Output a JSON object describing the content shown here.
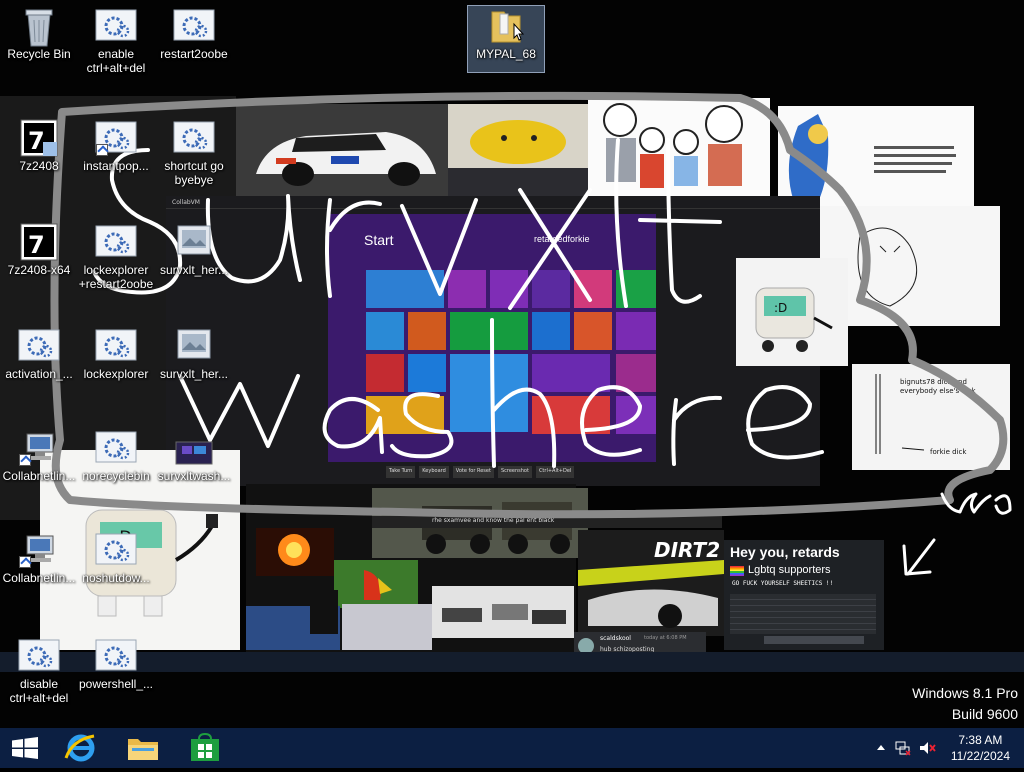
{
  "desktop": {
    "icons": [
      {
        "label": "Recycle Bin",
        "kind": "recycle-bin"
      },
      {
        "label": "enable ctrl+alt+del",
        "kind": "script"
      },
      {
        "label": "restart2oobe",
        "kind": "script"
      },
      {
        "label": "MYPAL_68",
        "kind": "folder",
        "selected": true
      },
      {
        "label": "7z2408",
        "kind": "7zip-installer"
      },
      {
        "label": "instantpop...",
        "kind": "script"
      },
      {
        "label": "shortcut go byebye",
        "kind": "script"
      },
      {
        "label": "7z2408-x64",
        "kind": "7zip-installer"
      },
      {
        "label": "lockexplorer +restart2oobe",
        "kind": "script"
      },
      {
        "label": "survxlt_her...",
        "kind": "image-file"
      },
      {
        "label": "activation_...",
        "kind": "script"
      },
      {
        "label": "lockexplorer",
        "kind": "script"
      },
      {
        "label": "survxlt_her...",
        "kind": "image-file"
      },
      {
        "label": "Collabnetlin...",
        "kind": "network-shortcut"
      },
      {
        "label": "norecyclebin",
        "kind": "script"
      },
      {
        "label": "survxltwash...",
        "kind": "image-file"
      },
      {
        "label": "Collabnetlin...",
        "kind": "network-shortcut"
      },
      {
        "label": "noshutdow...",
        "kind": "script"
      },
      {
        "label": "disable ctrl+alt+del",
        "kind": "script"
      },
      {
        "label": "powershell_...",
        "kind": "script"
      }
    ]
  },
  "wallpaper": {
    "start_title": "Start",
    "start_user": "retardedforkie",
    "collabvm_title": "CollabVM",
    "collabvm_buttons": [
      "Take Turn",
      "Keyboard",
      "Vote for Reset",
      "Screenshot",
      "Ctrl+Alt+Del"
    ],
    "meme_heading": "Hey you, retards",
    "meme_line": "Lgbtq supporters",
    "meme_sub": "GO FUCK YOURSELF SHEETICS !!",
    "meme_caption": "rhe sxamvee and know the pal ent black",
    "chat_user": "scaldskool",
    "chat_text": "hub schizoposting",
    "chat_time": "today at 6:08 PM",
    "note_text": "bignuts78 dick and everybody else's dick",
    "note_forkie": "forkie dick",
    "card_game": "DIRT2",
    "graffiti": [
      "survxlt",
      "was here",
      "vm6"
    ],
    "doodle_color": "#ffffff"
  },
  "taskbar": {
    "pinned": [
      "start-button",
      "internet-explorer",
      "file-explorer",
      "windows-store"
    ],
    "clock_time": "7:38 AM",
    "clock_date": "11/22/2024",
    "tray_icons": [
      "show-hidden-icons",
      "network",
      "volume-muted"
    ]
  },
  "watermark": {
    "edition": "Windows 8.1 Pro",
    "build": "Build 9600"
  },
  "colors": {
    "taskbar_bg": "#0c1f42",
    "start_screen_bg": "#3b1a6c",
    "accent_folder": "#e5c15d"
  }
}
